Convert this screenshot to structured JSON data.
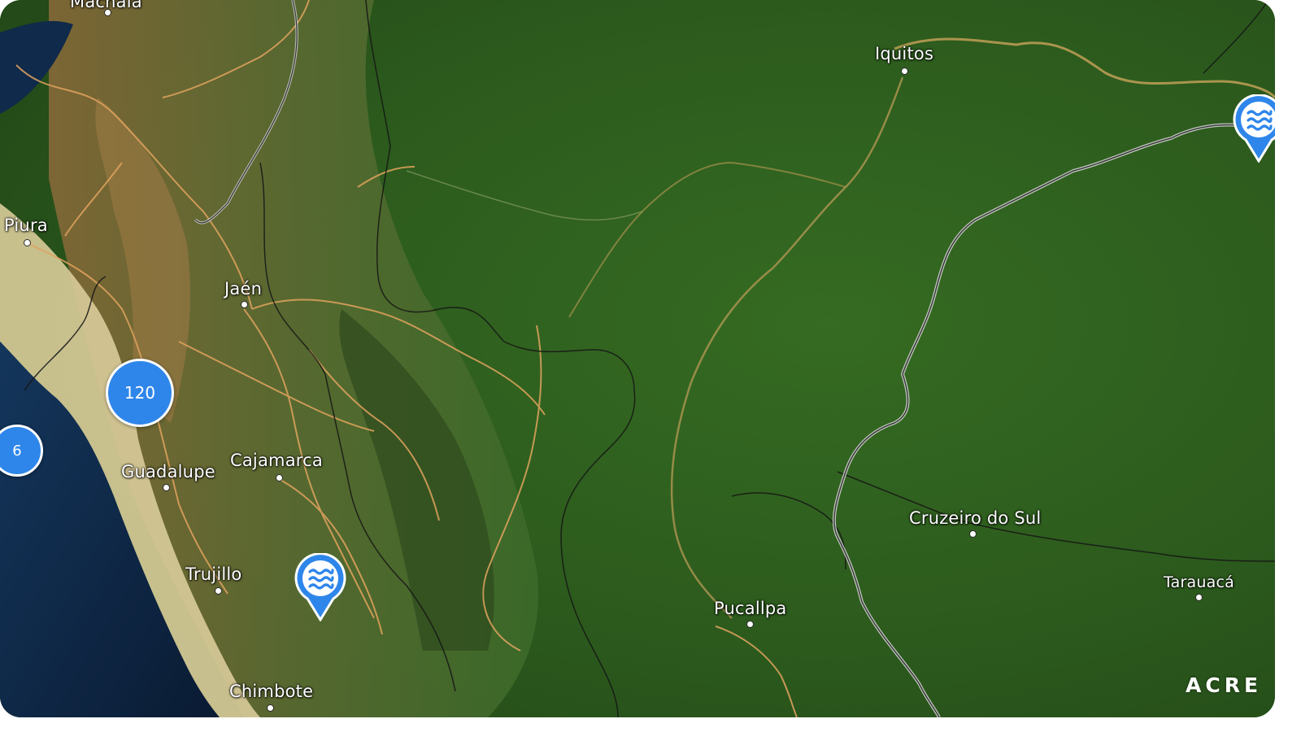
{
  "map": {
    "places": [
      {
        "id": "piura",
        "name": "Piura"
      },
      {
        "id": "jaen",
        "name": "Jaén"
      },
      {
        "id": "cajamarca",
        "name": "Cajamarca"
      },
      {
        "id": "guadalupe",
        "name": "Guadalupe"
      },
      {
        "id": "trujillo",
        "name": "Trujillo"
      },
      {
        "id": "chimbote",
        "name": "Chimbote"
      },
      {
        "id": "iquitos",
        "name": "Iquitos"
      },
      {
        "id": "pucallpa",
        "name": "Pucallpa"
      },
      {
        "id": "cruzeiro",
        "name": "Cruzeiro do Sul"
      },
      {
        "id": "tarauaca",
        "name": "Tarauacá"
      },
      {
        "id": "machala",
        "name": "Machala"
      }
    ],
    "clusters": [
      {
        "id": "cluster-120",
        "count": "120"
      },
      {
        "id": "cluster-6",
        "count": "6"
      }
    ],
    "markers": [
      {
        "id": "water-marker-1",
        "icon": "water-waves-icon"
      },
      {
        "id": "water-marker-2",
        "icon": "water-waves-icon"
      }
    ],
    "colors": {
      "cluster": "#2f86ea",
      "marker": "#2f86ea",
      "ocean": "#0d2340",
      "rainforest": "#2e5c1f",
      "desert": "#d9cc9a",
      "roads": "#e0a35e",
      "borders": "#1a1a1a"
    }
  },
  "brand": {
    "name": "ACRE"
  }
}
